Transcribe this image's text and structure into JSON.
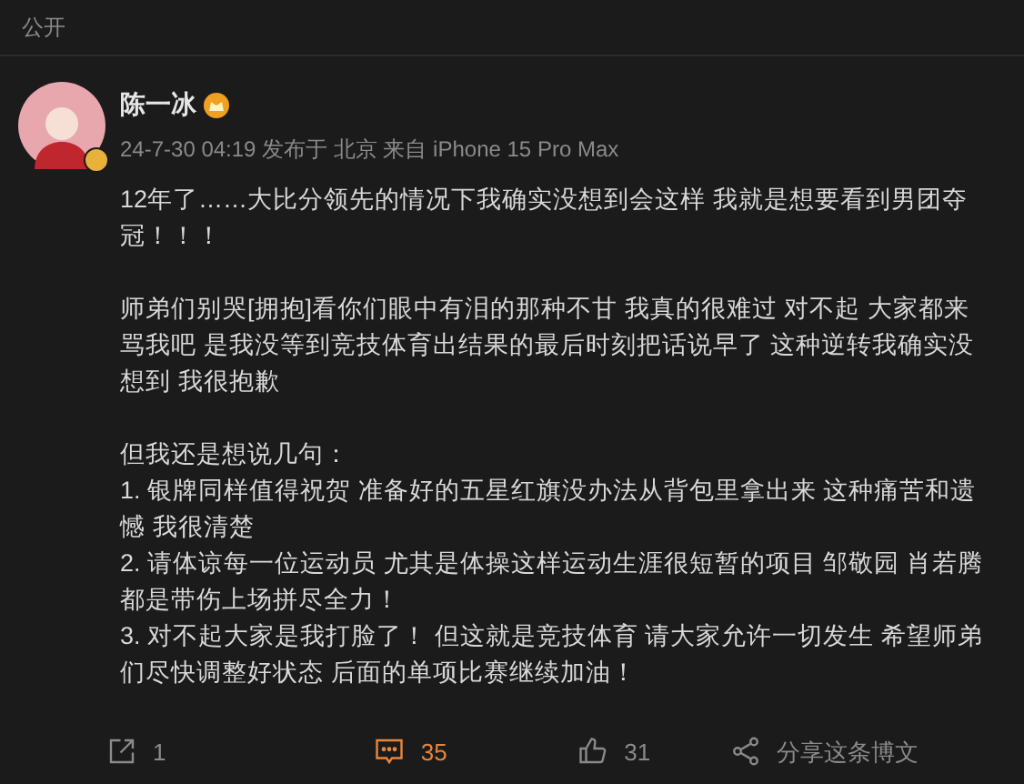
{
  "visibility": "公开",
  "post": {
    "author": "陈一冰",
    "meta": "24-7-30 04:19 发布于 北京 来自 iPhone 15 Pro Max",
    "paragraphs": [
      [
        "12年了……大比分领先的情况下我确实没想到会这样 我就是想要看到男团夺冠！！！"
      ],
      [
        "师弟们别哭[拥抱]看你们眼中有泪的那种不甘 我真的很难过 对不起 大家都来骂我吧 是我没等到竞技体育出结果的最后时刻把话说早了 这种逆转我确实没想到 我很抱歉"
      ],
      [
        "但我还是想说几句：",
        "1. 银牌同样值得祝贺 准备好的五星红旗没办法从背包里拿出来 这种痛苦和遗憾 我很清楚",
        "2. 请体谅每一位运动员 尤其是体操这样运动生涯很短暂的项目 邹敬园 肖若腾都是带伤上场拼尽全力！",
        "3. 对不起大家是我打脸了！ 但这就是竞技体育 请大家允许一切发生 希望师弟们尽快调整好状态 后面的单项比赛继续加油！"
      ]
    ]
  },
  "actions": [
    {
      "kind": "share",
      "count": "1",
      "selected": false
    },
    {
      "kind": "comment",
      "count": "35",
      "selected": true
    },
    {
      "kind": "like",
      "count": "31",
      "selected": false
    },
    {
      "kind": "forward",
      "label": "分享这条博文",
      "selected": false
    }
  ]
}
